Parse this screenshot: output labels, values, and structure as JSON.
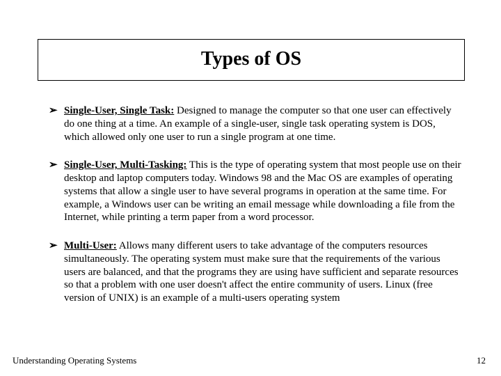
{
  "title": "Types of OS",
  "bullet_glyph": "➢",
  "items": [
    {
      "term": "Single-User, Single Task:",
      "desc": "  Designed to manage the computer so that one user can effectively do one thing at a time.  An example of a single-user, single task operating system is DOS, which allowed only one user to run a single program at one time."
    },
    {
      "term": "Single-User, Multi-Tasking:",
      "desc": "  This is the type of operating system that most people use on their desktop and laptop computers today.   Windows 98 and the Mac OS are examples of operating systems that allow a single user to have several programs in operation at the same time.  For example, a Windows user can be writing an email message while downloading a file from the Internet, while printing a term paper from a word processor."
    },
    {
      "term": "Multi-User:",
      "desc": "  Allows many different users to take advantage of the computers resources simultaneously.  The operating system must make sure that the requirements of the various users are balanced, and that the programs they are using have sufficient and separate resources so that a problem with one user doesn't affect the entire community of users.  Linux (free version of UNIX) is an example of a multi-users operating system"
    }
  ],
  "footer": {
    "left": "Understanding Operating Systems",
    "right": "12"
  }
}
